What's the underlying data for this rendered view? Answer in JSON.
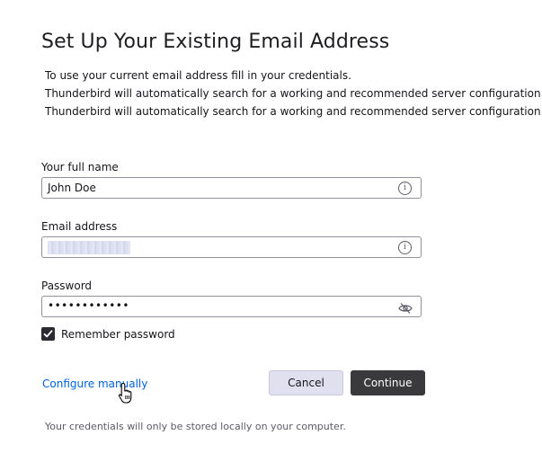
{
  "header": {
    "title": "Set Up Your Existing Email Address",
    "intro_lines": [
      "To use your current email address fill in your credentials.",
      "Thunderbird will automatically search for a working and recommended server configuration.",
      "Thunderbird will automatically search for a working and recommended server configuration."
    ]
  },
  "form": {
    "name": {
      "label": "Your full name",
      "value": "John Doe",
      "icon": "info-icon"
    },
    "email": {
      "label": "Email address",
      "value_hidden": true,
      "icon": "info-icon"
    },
    "password": {
      "label": "Password",
      "masked_value": "••••••••••••",
      "icon": "eye-slash-icon"
    },
    "remember": {
      "label": "Remember password",
      "checked": true
    }
  },
  "actions": {
    "configure_manually": "Configure manually",
    "cancel": "Cancel",
    "continue": "Continue"
  },
  "footer": {
    "note": "Your credentials will only be stored locally on your computer."
  },
  "colors": {
    "link": "#0061e0",
    "primary_button": "#3a3a3d",
    "secondary_button": "#e0e0ef",
    "checkbox": "#2b2a33"
  }
}
